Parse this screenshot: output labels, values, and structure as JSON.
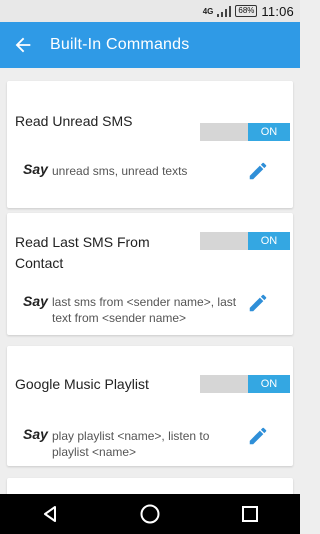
{
  "status_bar": {
    "network": "4G",
    "battery": "68%",
    "time": "11:06"
  },
  "toolbar": {
    "title": "Built-In Commands",
    "back_icon": "arrow-back-icon",
    "color": "#2f9ae6"
  },
  "commands": [
    {
      "title": "Read Unread SMS",
      "toggle_label": "ON",
      "say_label": "Say",
      "examples": "unread sms, unread texts"
    },
    {
      "title": "Read Last SMS From Contact",
      "toggle_label": "ON",
      "say_label": "Say",
      "examples": "last sms from <sender name>, last text from <sender name>"
    },
    {
      "title": "Google Music Playlist",
      "toggle_label": "ON",
      "say_label": "Say",
      "examples": "play playlist <name>, listen to playlist <name>"
    }
  ],
  "nav_bar": {
    "back": "nav-back-icon",
    "home": "nav-home-icon",
    "recents": "nav-recents-icon"
  },
  "accent_color": "#34a7e2"
}
